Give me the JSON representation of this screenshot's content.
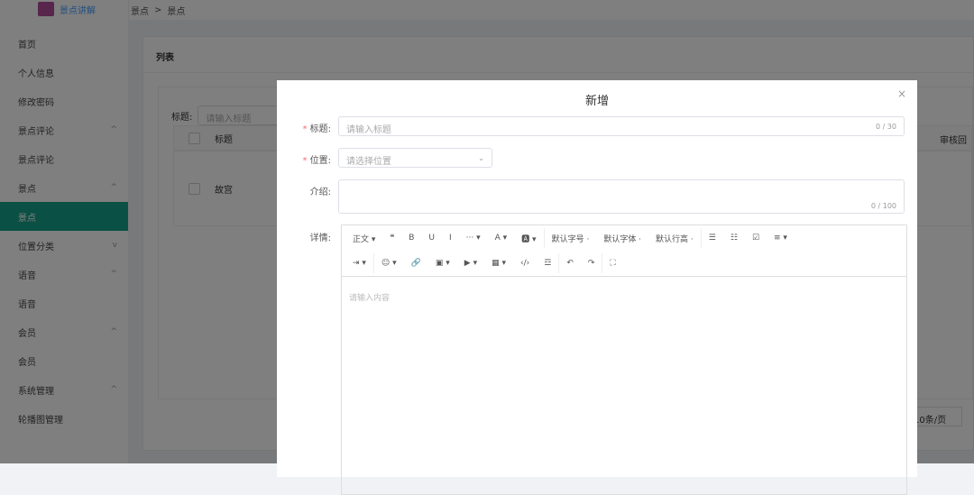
{
  "app": {
    "title": "景点讲解"
  },
  "breadcrumb": [
    "景点",
    "景点"
  ],
  "sidebar": {
    "items": [
      {
        "label": "首页"
      },
      {
        "label": "个人信息"
      },
      {
        "label": "修改密码"
      },
      {
        "label": "景点评论",
        "chev": "^"
      },
      {
        "label": "景点评论",
        "sub": true
      },
      {
        "label": "景点",
        "chev": "^"
      },
      {
        "label": "景点",
        "sub": true,
        "active": true
      },
      {
        "label": "位置分类",
        "chev": "v"
      },
      {
        "label": "语音",
        "chev": "^"
      },
      {
        "label": "语音",
        "sub": true
      },
      {
        "label": "会员",
        "chev": "^"
      },
      {
        "label": "会员",
        "sub": true
      },
      {
        "label": "系统管理",
        "chev": "^"
      },
      {
        "label": "轮播图管理",
        "sub": true
      }
    ]
  },
  "list": {
    "title": "列表",
    "search_label": "标题:",
    "search_placeholder": "请输入标题",
    "col_title": "标题",
    "col_audit": "审核回",
    "row_title": "故宫",
    "page_size": "10条/页"
  },
  "modal": {
    "title": "新增",
    "close": "×",
    "title_label": "标题:",
    "title_placeholder": "请输入标题",
    "title_count": "0 / 30",
    "location_label": "位置:",
    "location_placeholder": "请选择位置",
    "intro_label": "介绍:",
    "intro_count": "0 / 100",
    "detail_label": "详情:",
    "editor_placeholder": "请输入内容",
    "toolbar1": [
      "正文 ▾",
      "❝",
      "B",
      "U",
      "I",
      "··· ▾",
      "A ▾",
      "🅰 ▾",
      "|",
      "默认字号 ·",
      "默认字体 ·",
      "默认行高 ·",
      "|",
      "☰",
      "☷",
      "☑",
      "≡ ▾"
    ],
    "toolbar2": [
      "⇥ ▾",
      "|",
      "☺ ▾",
      "🔗",
      "▣ ▾",
      "▶ ▾",
      "▦ ▾",
      "‹/›",
      "☲",
      "|",
      "↶",
      "↷",
      "|",
      "⛶"
    ]
  }
}
